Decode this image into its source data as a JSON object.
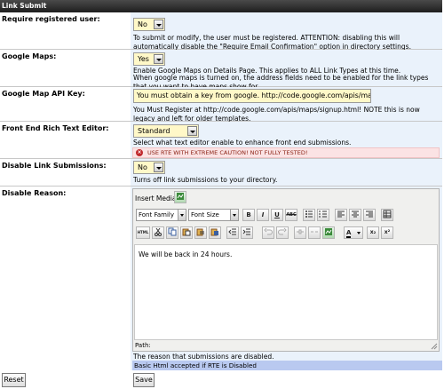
{
  "titlebar": {
    "title": "Link Submit"
  },
  "rows": {
    "require_user": {
      "label": "Require registered user:",
      "value": "No",
      "desc": "To submit or modify, the user must be registered. ATTENTION: disabling this will automatically disable the \"Require Email Confirmation\" option in directory settings."
    },
    "google_maps": {
      "label": "Google Maps:",
      "value": "Yes",
      "desc1": "Enable Google Maps on Details Page. This applies to ALL Link Types at this time.",
      "desc2": "When google maps is turned on, the address fields need to be enabled for the link types that you want to have maps show for."
    },
    "api_key": {
      "label": "Google Map API Key:",
      "value": "You must obtain a key from google. http://code.google.com/apis/maps/sig",
      "desc": "You Must Register at http://code.google.com/apis/maps/signup.html! NOTE this is now legacy and left for older templates."
    },
    "rte": {
      "label": "Front End Rich Text Editor:",
      "value": "Standard",
      "desc": "Select what text editor enable to enhance front end submissions.",
      "warning": "USE RTE WITH EXTREME CAUTION! NOT FULLY TESTED!"
    },
    "disable_links": {
      "label": "Disable Link Submissions:",
      "value": "No",
      "desc": "Turns off link submissions to your directory."
    },
    "disable_reason": {
      "label": "Disable Reason:",
      "insert_media": "Insert Media",
      "font_family": "Font Family",
      "font_size": "Font Size",
      "content": "We will be back in 24 hours.",
      "path_label": "Path:",
      "desc": "The reason that submissions are disabled.",
      "note": "Basic Html accepted if RTE is Disabled"
    }
  },
  "toolbar": {
    "bold": "B",
    "italic": "I",
    "underline": "U",
    "strike": "ABC",
    "html": "HTML",
    "sub": "x₂",
    "sup": "x²",
    "font_color": "A"
  },
  "buttons": {
    "reset": "Reset",
    "save": "Save"
  },
  "icons": [
    "media-icon",
    "cut-icon",
    "copy-icon",
    "paste-icon",
    "paste-text-icon",
    "paste-word-icon",
    "undo-icon",
    "redo-icon",
    "link-icon",
    "unlink-icon",
    "image-icon",
    "font-color-icon",
    "subscript-icon",
    "superscript-icon",
    "bullet-list-icon",
    "numbered-list-icon",
    "align-left-icon",
    "align-center-icon",
    "align-right-icon",
    "table-icon",
    "resize-grip-icon",
    "error-icon"
  ]
}
